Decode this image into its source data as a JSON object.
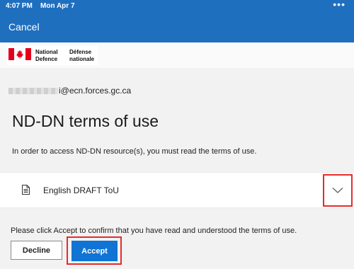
{
  "status_bar": {
    "time": "4:07 PM",
    "date": "Mon Apr 7",
    "more": "•••"
  },
  "nav": {
    "cancel_label": "Cancel"
  },
  "logo": {
    "en_line1": "National",
    "en_line2": "Defence",
    "fr_line1": "Défense",
    "fr_line2": "nationale",
    "flag_icon": "canada-flag-icon"
  },
  "account": {
    "email_visible_suffix": "i@ecn.forces.gc.ca"
  },
  "page": {
    "title": "ND-DN terms of use",
    "intro": "In order to access ND-DN resource(s), you must read the terms of use."
  },
  "terms": {
    "document_label": "English DRAFT ToU",
    "document_icon": "document-icon",
    "expand_icon": "chevron-down-icon"
  },
  "footer": {
    "confirm_text": "Please click Accept to confirm that you have read and understood the terms of use.",
    "decline_label": "Decline",
    "accept_label": "Accept"
  },
  "colors": {
    "header": "#1f6fbf",
    "accent": "#0f74d4",
    "highlight": "#e52b2b"
  }
}
